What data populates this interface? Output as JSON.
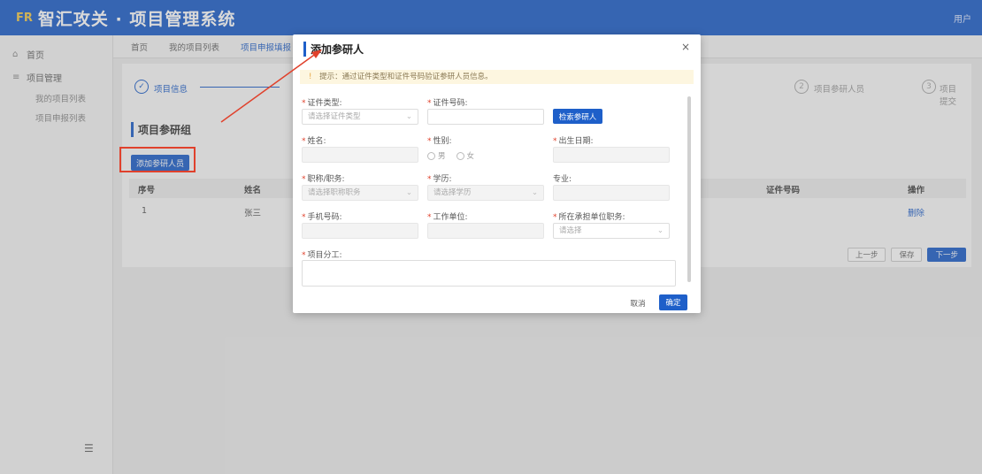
{
  "header": {
    "logo": "FR",
    "title": "智汇攻关 · 项目管理系统",
    "user": "用户"
  },
  "sidebar": {
    "home": "首页",
    "project_mgmt": "项目管理",
    "sub_items": [
      "我的项目列表",
      "项目申报列表"
    ]
  },
  "tabs": [
    "首页",
    "我的项目列表",
    "项目申报填报"
  ],
  "steps": [
    "项目信息",
    "项目参研人员",
    "项目提交"
  ],
  "main": {
    "section_title": "项目参研组",
    "add_button": "添加参研人员",
    "table_headers": [
      "序号",
      "姓名",
      "证件号码",
      "操作"
    ],
    "table_row": [
      "1",
      "张三",
      "删除"
    ],
    "pager": [
      "上一步",
      "保存",
      "下一步"
    ]
  },
  "modal": {
    "title": "添加参研人",
    "close": "×",
    "notice": "提示：通过证件类型和证件号码验证参研人员信息。",
    "labels": {
      "id_type": "证件类型:",
      "id_no": "证件号码:",
      "name": "姓名:",
      "gender": "性别:",
      "birth": "出生日期:",
      "title": "职称/职务:",
      "degree": "学历:",
      "major": "专业:",
      "phone": "手机号码:",
      "work_unit": "工作单位:",
      "role": "所在承担单位职务:",
      "duty": "项目分工:"
    },
    "placeholders": {
      "id_type": "请选择证件类型",
      "title": "请选择职称职务",
      "degree": "请选择学历",
      "role": "请选择"
    },
    "verify_button": "检索参研人",
    "gender_male": "男",
    "gender_female": "女",
    "cancel": "取消",
    "confirm": "确定"
  }
}
